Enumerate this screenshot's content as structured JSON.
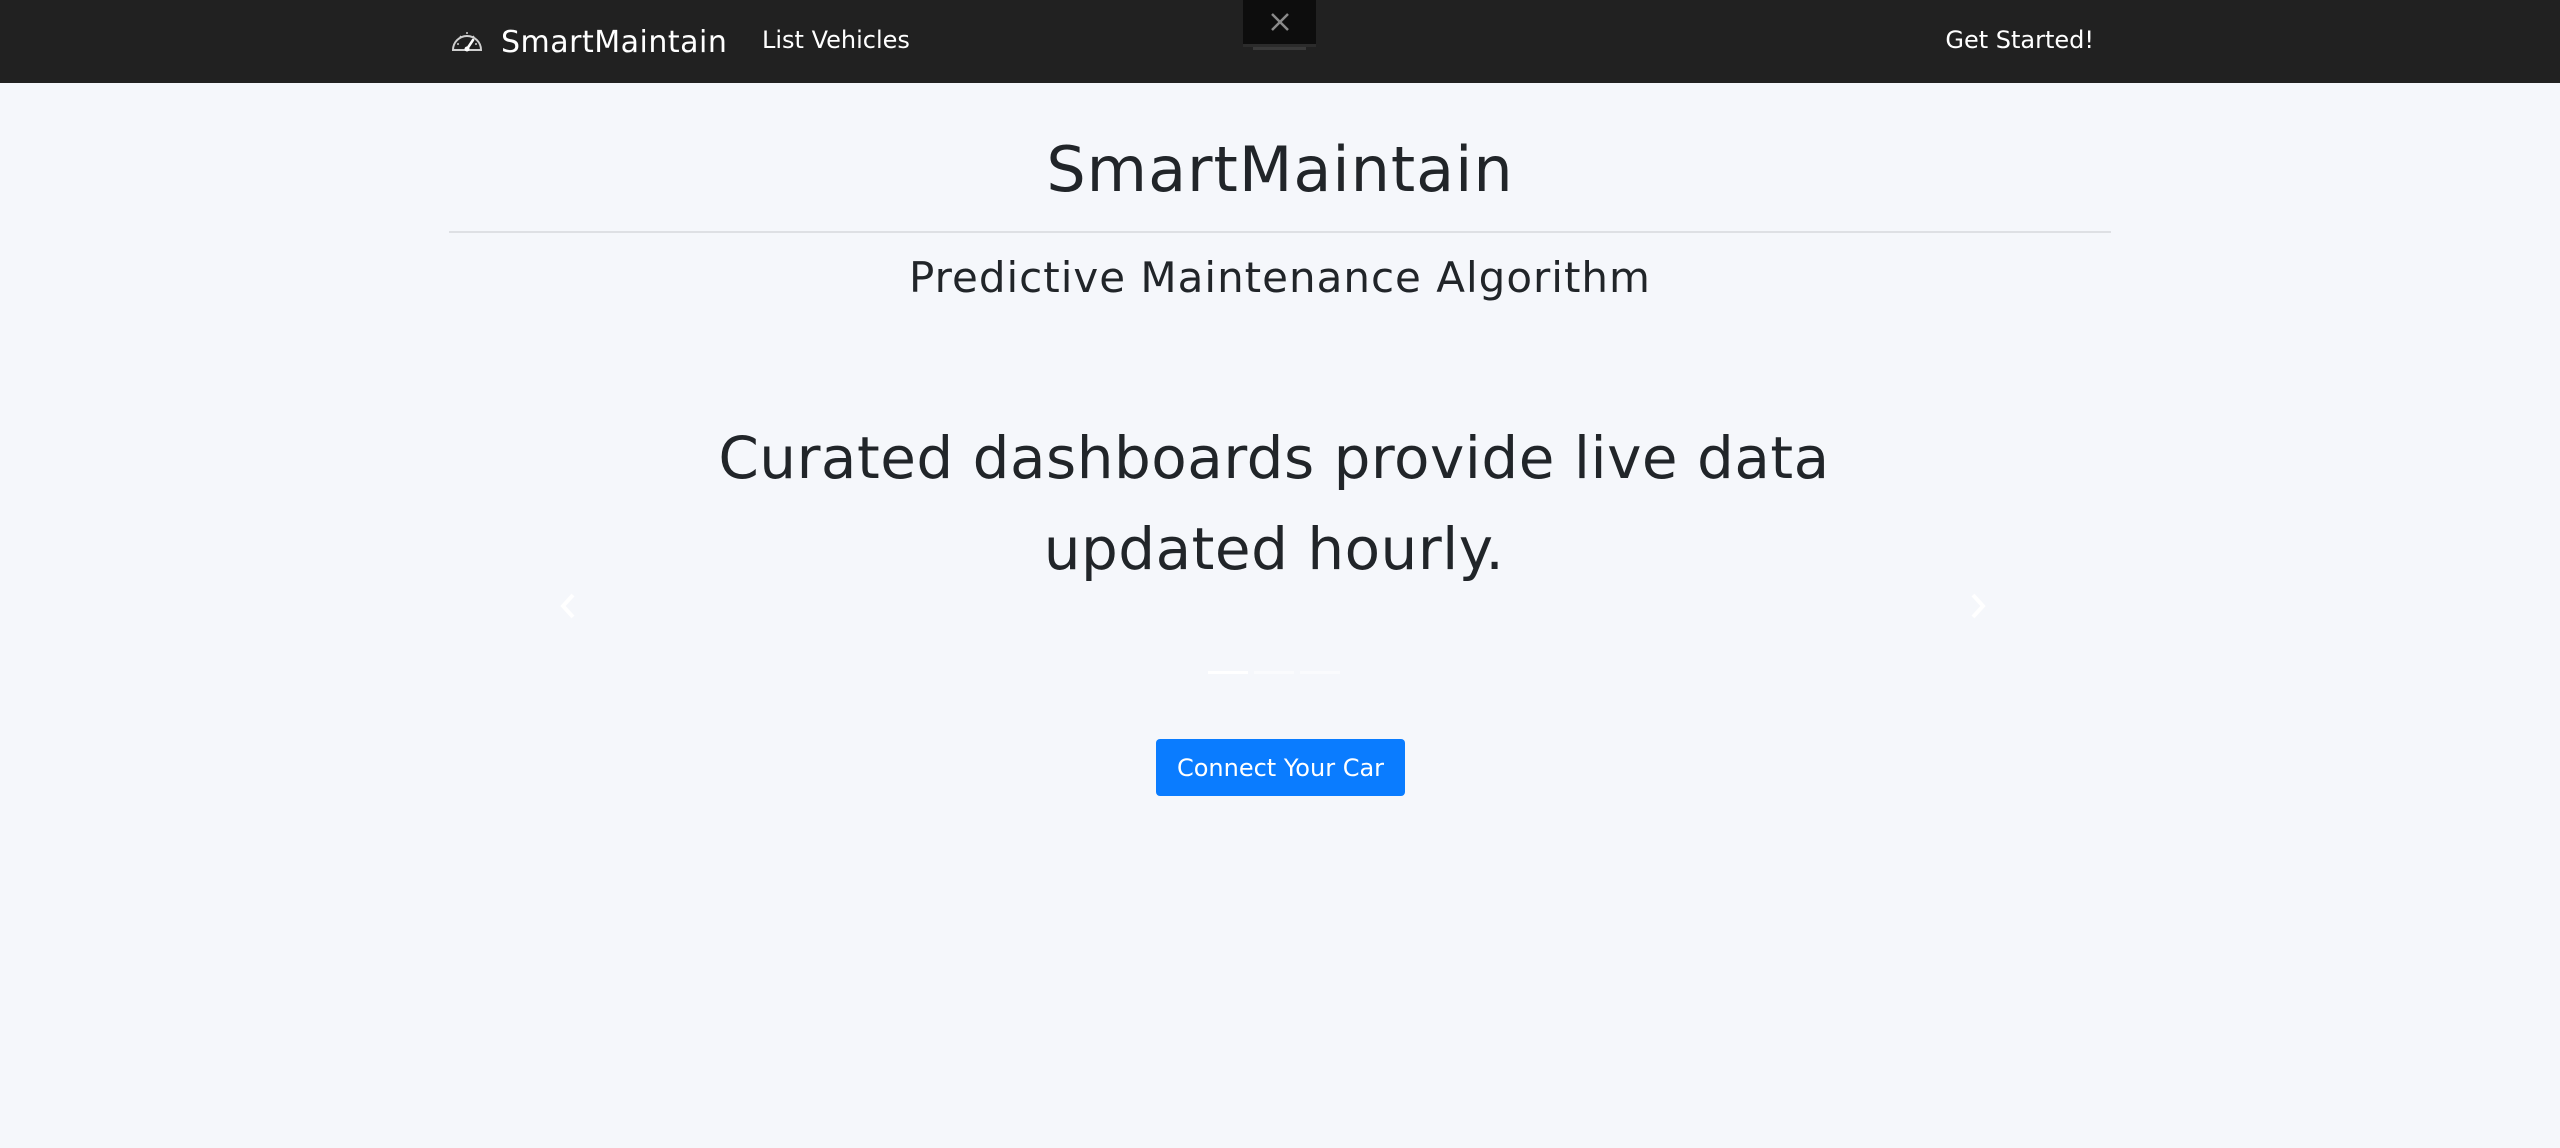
{
  "nav": {
    "brand_name": "SmartMaintain",
    "brand_icon": "speedometer-icon",
    "links": [
      "List Vehicles"
    ],
    "right_link": "Get Started!",
    "close_icon": "close-icon"
  },
  "hero": {
    "title": "SmartMaintain",
    "subtitle": "Predictive Maintenance Algorithm"
  },
  "carousel": {
    "slide_text": "Curated dashboards provide live data updated hourly.",
    "prev_icon": "chevron-left-icon",
    "next_icon": "chevron-right-icon"
  },
  "cta": {
    "label": "Connect Your Car",
    "color": "#0a7cff"
  },
  "colors": {
    "navbar_bg": "#212121",
    "page_bg": "#f5f7fb",
    "text": "#212529"
  }
}
